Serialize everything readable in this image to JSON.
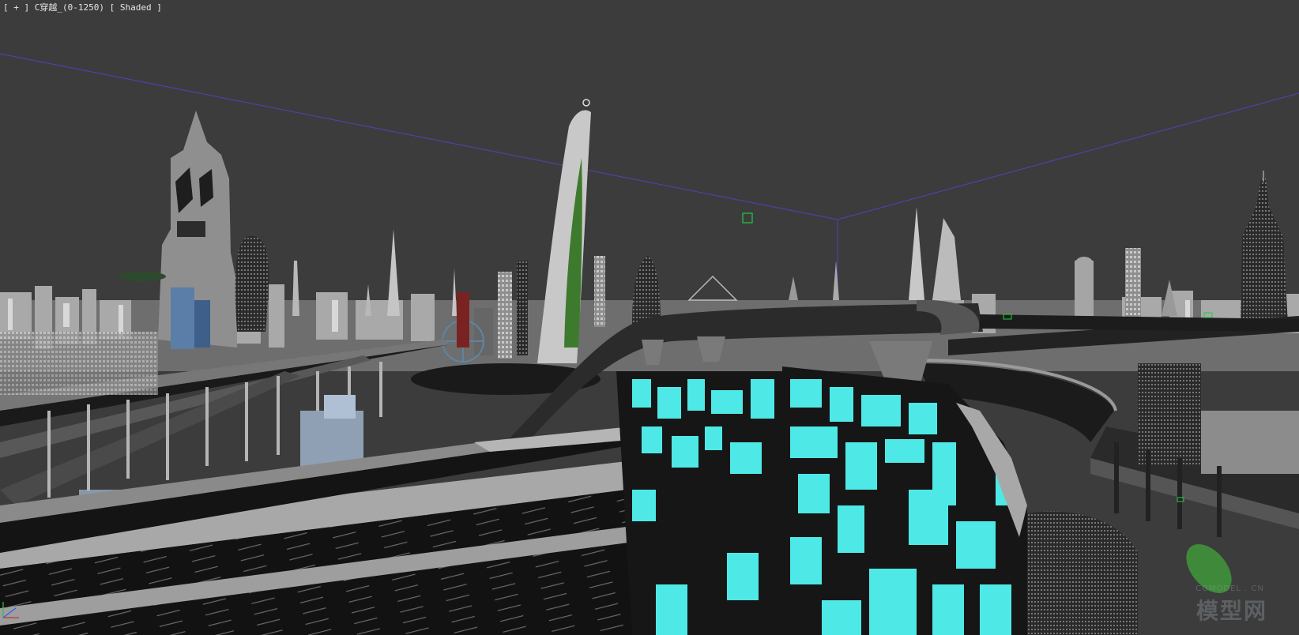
{
  "viewport": {
    "label_plus": "[ + ]",
    "label_camera": "C穿越_(0-1250)",
    "label_shading": "[ Shaded ]",
    "background_color": "#3c3c3c",
    "highlight_color": "#4ee9e6",
    "camera_line_color": "#5040a8",
    "selection_color": "#22cc44"
  },
  "watermark": {
    "sub": "CGMODEL . CN",
    "text": "模型网"
  }
}
